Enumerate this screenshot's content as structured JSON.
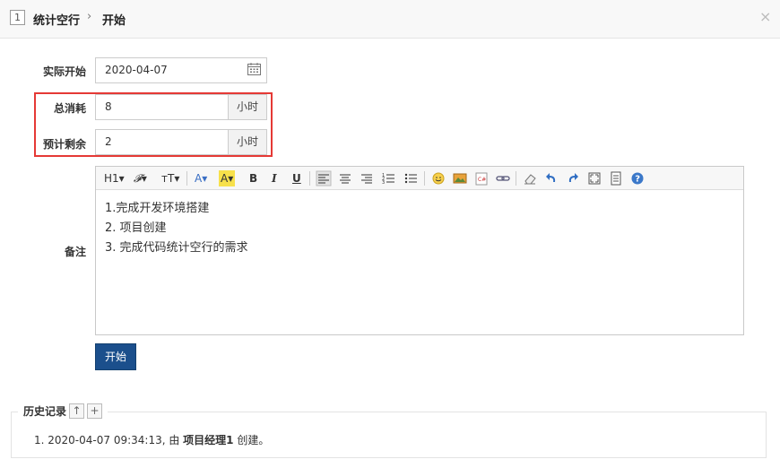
{
  "header": {
    "id": "1",
    "task_name": "统计空行",
    "separator": "›",
    "action": "开始",
    "close": "×"
  },
  "form": {
    "actual_start_label": "实际开始",
    "actual_start_value": "2020-04-07",
    "consumed_label": "总消耗",
    "consumed_value": "8",
    "consumed_unit": "小时",
    "left_label": "预计剩余",
    "left_value": "2",
    "left_unit": "小时",
    "comment_label": "备注",
    "comment_lines": [
      "1.完成开发环境搭建",
      "2. 项目创建",
      "3. 完成代码统计空行的需求"
    ],
    "submit_label": "开始"
  },
  "toolbar": {
    "heading": "H1▾",
    "font": "𝓕▾",
    "size": "тT▾",
    "font_color": "A▾",
    "bg_color": "A▾",
    "bold": "B",
    "italic": "I",
    "underline": "U"
  },
  "history": {
    "title": "历史记录",
    "collapse": "↑",
    "expand": "+",
    "entry_prefix": "1. 2020-04-07 09:34:13, 由 ",
    "entry_actor": "项目经理1",
    "entry_suffix": " 创建。"
  },
  "colors": {
    "highlight": "#e53935",
    "primary_button": "#1b4f8c"
  }
}
